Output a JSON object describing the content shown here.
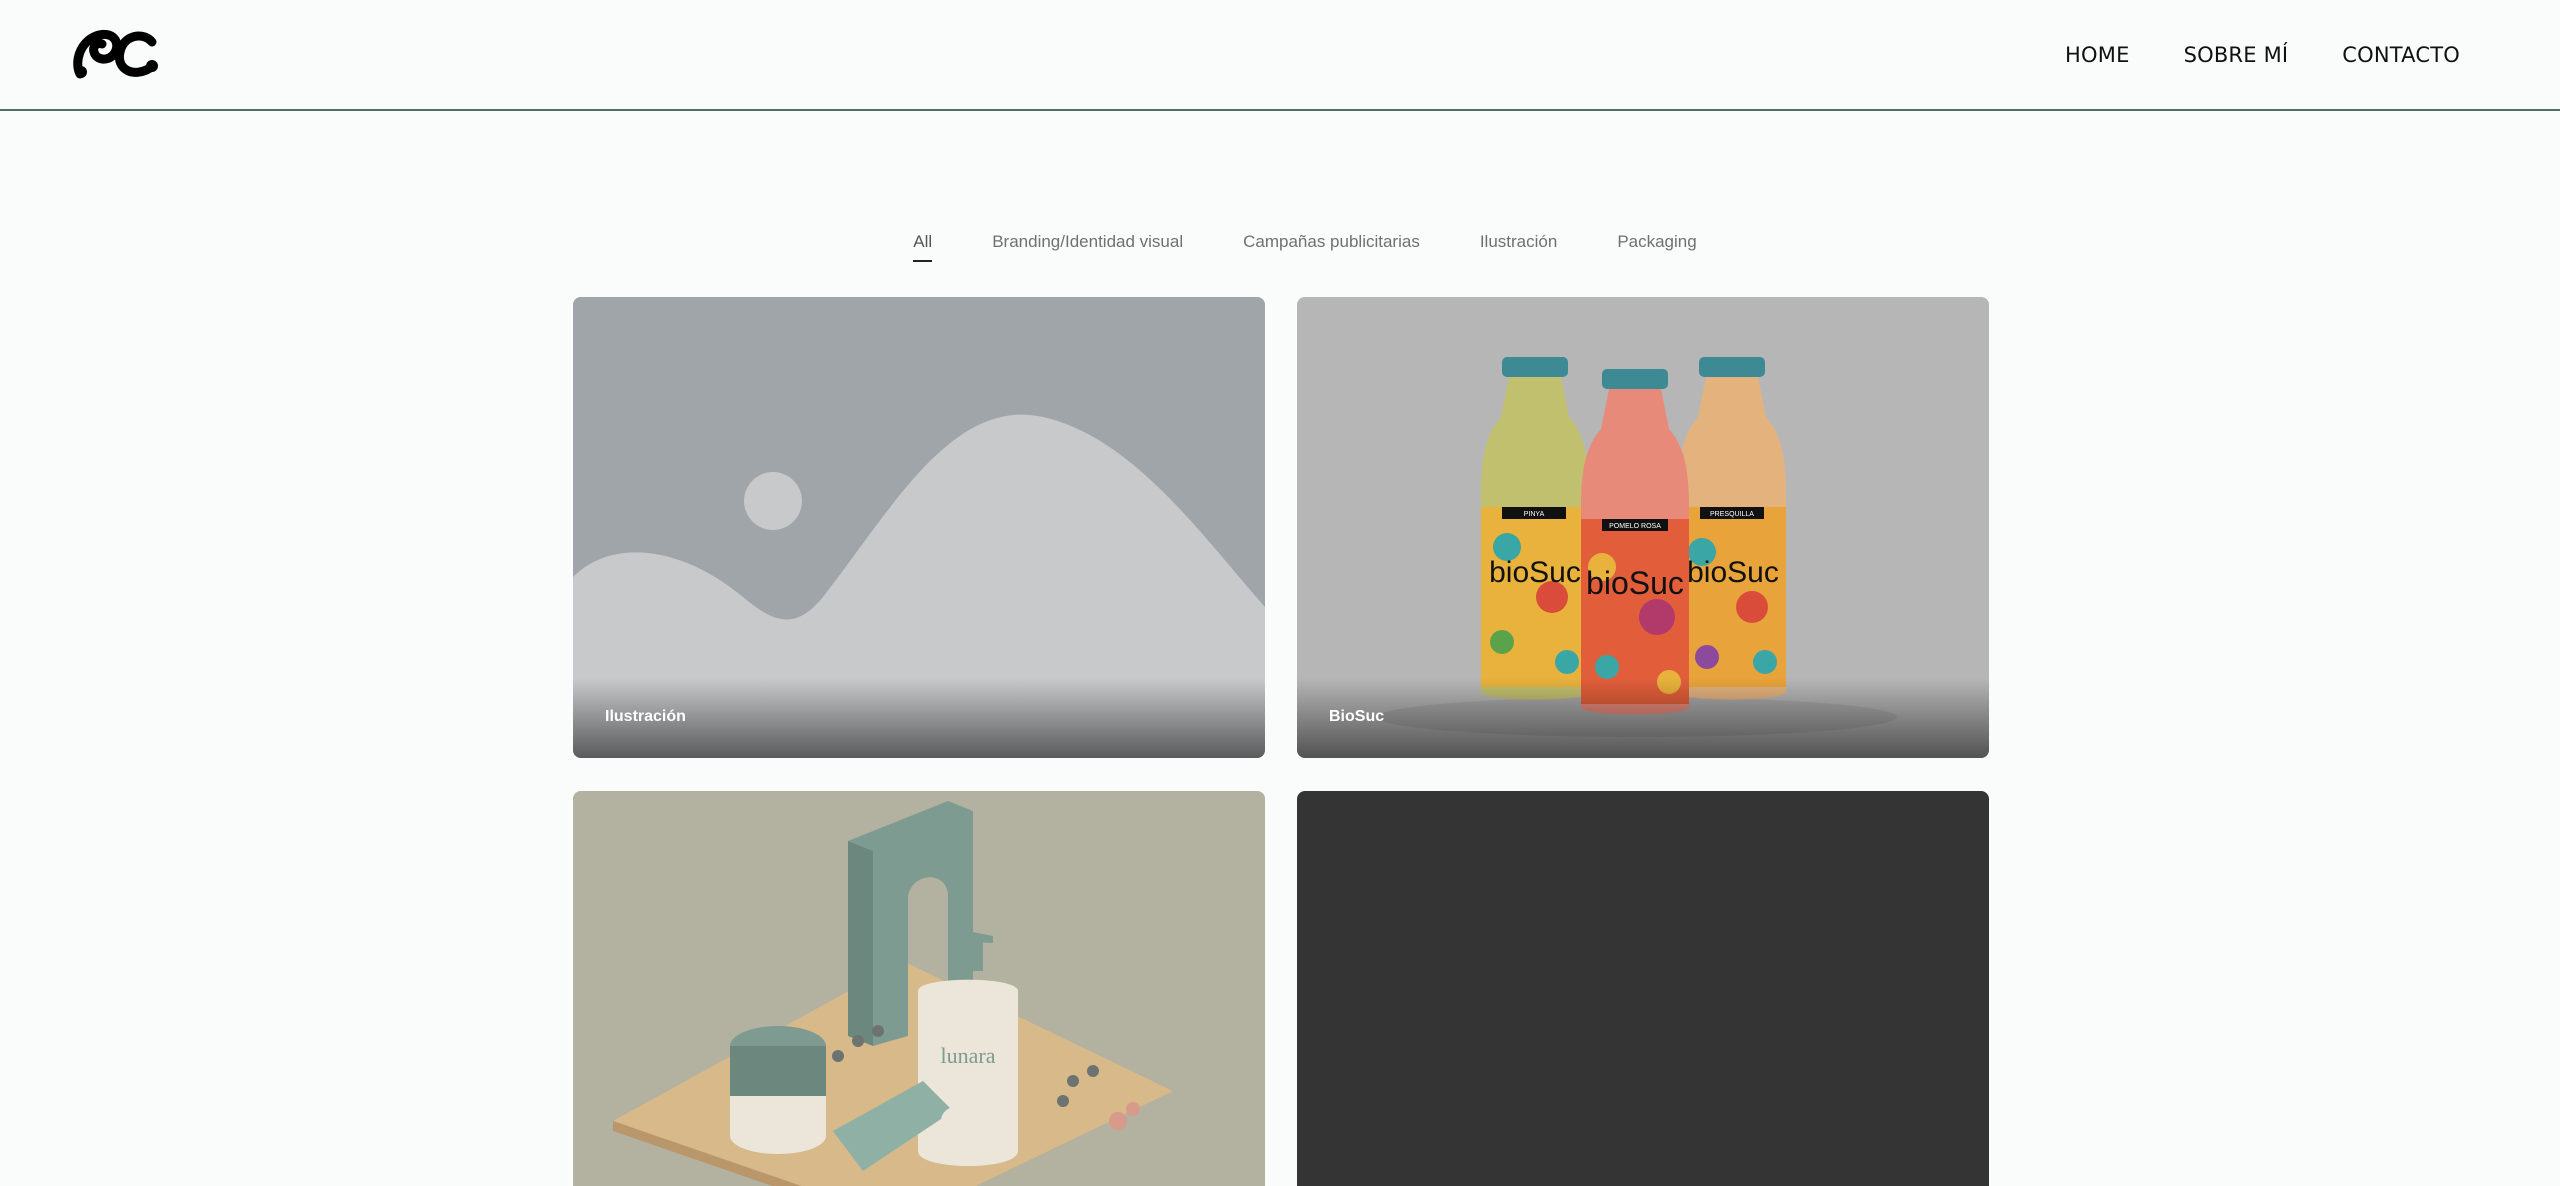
{
  "header": {
    "logo_alt": "PC",
    "nav": [
      "HOME",
      "SOBRE MÍ",
      "CONTACTO"
    ]
  },
  "filters": {
    "items": [
      "All",
      "Branding/Identidad visual",
      "Campañas publicitarias",
      "Ilustración",
      "Packaging"
    ],
    "active": "All"
  },
  "projects": [
    {
      "title": "Ilustración",
      "image": "placeholder-image-icon"
    },
    {
      "title": "BioSuc",
      "image": "juice-bottles-photo",
      "bottle_labels": [
        "PINYA",
        "POMELO ROSA",
        "PRESQUILLA"
      ],
      "brand": "bioSuc"
    },
    {
      "title": "",
      "image": "cosmetics-photo",
      "brand": "lunara"
    },
    {
      "title": "",
      "image": "dark-placeholder"
    }
  ],
  "colors": {
    "background": "#fafbfb",
    "header_border": "#4f6f66",
    "filter_text": "#707070"
  }
}
